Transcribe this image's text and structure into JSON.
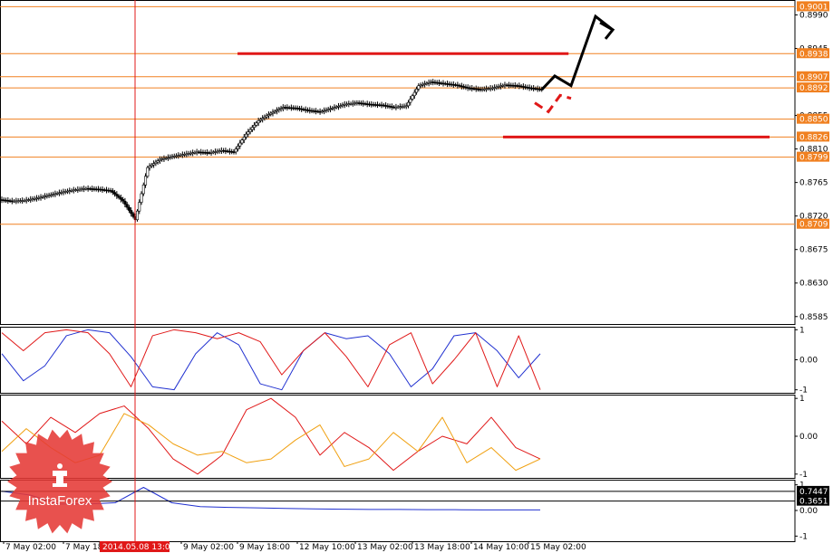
{
  "colors": {
    "level": "#f08020",
    "red": "#e01818",
    "blue": "#2030d0",
    "purple": "#8030a0",
    "orange": "#f0a010",
    "tag_bg": "#f08020",
    "dark_tag": "#000000",
    "brand": "#e53935"
  },
  "brand": {
    "name": "InstaForex",
    "icon": "instaforex-emblem-icon"
  },
  "chart_data": [
    {
      "type": "candlestick",
      "ylim": [
        0.8575,
        0.901
      ],
      "y_ticks": [
        "0.8990",
        "0.8945",
        "0.8855",
        "0.8810",
        "0.8765",
        "0.8720",
        "0.8675",
        "0.8630",
        "0.8585"
      ],
      "y_tick_values": [
        0.899,
        0.8945,
        0.8855,
        0.881,
        0.8765,
        0.872,
        0.8675,
        0.863,
        0.8585
      ],
      "levels": [
        {
          "label": "0.9001",
          "value": 0.9001
        },
        {
          "label": "0.8938",
          "value": 0.8938
        },
        {
          "label": "0.8907",
          "value": 0.8907
        },
        {
          "label": "0.8892",
          "value": 0.8892
        },
        {
          "label": "0.8850",
          "value": 0.885
        },
        {
          "label": "0.8826",
          "value": 0.8826
        },
        {
          "label": "0.8799",
          "value": 0.8799
        },
        {
          "label": "0.8709",
          "value": 0.8709
        }
      ],
      "price_path": [
        0.8742,
        0.874,
        0.8741,
        0.8744,
        0.8748,
        0.8752,
        0.8755,
        0.8757,
        0.8756,
        0.8754,
        0.874,
        0.8715,
        0.8785,
        0.8796,
        0.88,
        0.8803,
        0.8806,
        0.8805,
        0.8808,
        0.8806,
        0.883,
        0.8848,
        0.8858,
        0.8866,
        0.8865,
        0.8862,
        0.886,
        0.8865,
        0.887,
        0.8872,
        0.887,
        0.8869,
        0.8866,
        0.8868,
        0.8895,
        0.89,
        0.8898,
        0.8896,
        0.8892,
        0.889,
        0.8892,
        0.8896,
        0.8895,
        0.8892,
        0.889
      ],
      "support_resistance": [
        {
          "value": 0.8938,
          "from_index": 17,
          "to_index": 40
        },
        {
          "value": 0.8826,
          "from_index": 36,
          "to_index": 57
        }
      ],
      "forecast_black": [
        0.889,
        0.8908,
        0.8895,
        0.8988,
        0.897
      ],
      "forecast_red": [
        0.8872,
        0.886,
        0.8882,
        0.8878
      ],
      "vertical_marker_index": 12
    },
    {
      "type": "line",
      "ylim": [
        -1.1,
        1.1
      ],
      "y_ticks": [
        "1",
        "0.00",
        "-1"
      ],
      "series": [
        {
          "color_key": "blue",
          "values": [
            0.2,
            -0.7,
            -0.2,
            0.8,
            1.0,
            0.9,
            0.1,
            -0.9,
            -1.0,
            0.2,
            0.9,
            0.5,
            -0.8,
            -1.0,
            0.3,
            0.9,
            0.7,
            0.8,
            0.2,
            -0.9,
            -0.3,
            0.8,
            0.9,
            0.3,
            -0.6,
            0.2
          ]
        },
        {
          "color_key": "red",
          "values": [
            0.9,
            0.3,
            0.9,
            1.0,
            0.9,
            0.2,
            -0.9,
            0.8,
            1.0,
            0.9,
            0.7,
            0.9,
            0.6,
            -0.5,
            0.3,
            0.9,
            0.1,
            -0.9,
            0.5,
            0.9,
            -0.8,
            0.0,
            0.9,
            -0.9,
            0.8,
            -1.0
          ]
        },
        {
          "color_key": "black",
          "values": [
            0.4,
            -0.1,
            -0.8,
            -1.0,
            -0.9,
            0.1,
            0.9,
            1.0,
            0.9,
            0.8,
            0.9,
            0.8,
            0.4,
            -0.6,
            0.2,
            0.9,
            0.3,
            -0.8,
            0.6,
            0.9,
            -0.9,
            -0.1,
            0.9,
            -0.9,
            0.8,
            -1.0
          ]
        }
      ]
    },
    {
      "type": "line",
      "ylim": [
        -1.1,
        1.1
      ],
      "y_ticks": [
        "1",
        "0.00",
        "-1"
      ],
      "series": [
        {
          "color_key": "red",
          "values": [
            0.4,
            -0.2,
            0.5,
            0.1,
            0.6,
            0.8,
            0.2,
            -0.6,
            -1.0,
            -0.5,
            0.7,
            1.0,
            0.5,
            -0.5,
            0.1,
            -0.3,
            -0.9,
            -0.4,
            0.0,
            -0.2,
            0.5,
            -0.3,
            -0.6
          ]
        },
        {
          "color_key": "orange",
          "values": [
            -0.4,
            0.2,
            -0.3,
            -0.7,
            -0.5,
            0.6,
            0.3,
            -0.2,
            -0.5,
            -0.4,
            -0.7,
            -0.6,
            -0.1,
            0.3,
            -0.8,
            -0.6,
            0.1,
            -0.4,
            0.5,
            -0.7,
            -0.3,
            -0.9,
            -0.6
          ]
        },
        {
          "color_key": "black",
          "values": [
            0.8,
            0.6,
            0.4,
            -0.3,
            -0.7,
            -0.9,
            -0.5,
            -0.2,
            0.0,
            -0.3,
            -0.5,
            -0.4,
            -0.2,
            0.0,
            0.4,
            0.8,
            0.5,
            0.1,
            0.0,
            -0.1,
            -0.2,
            0.1,
            0.4
          ]
        }
      ]
    },
    {
      "type": "line",
      "ylim": [
        -1.2,
        1.2
      ],
      "y_ticks": [
        "1",
        "0.00",
        "-1"
      ],
      "tags": [
        {
          "label": "0.7447",
          "value": 0.7447
        },
        {
          "label": "0.3651",
          "value": 0.3651
        }
      ],
      "series": [
        {
          "color_key": "blue",
          "values": [
            0.75,
            0.6,
            0.25,
            0.25,
            0.3,
            0.9,
            0.3,
            0.15,
            0.12,
            0.1,
            0.08,
            0.06,
            0.05,
            0.04,
            0.04,
            0.03,
            0.03,
            0.02,
            0.02,
            0.02
          ]
        }
      ]
    }
  ],
  "x_axis": {
    "labels": [
      "7 May 02:00",
      "7 May 18:00",
      "2014.05.08 13:00",
      "9 May 02:00",
      "9 May 18:00",
      "12 May 10:00",
      "13 May 02:00",
      "13 May 18:00",
      "14 May 10:00",
      "15 May 02:00"
    ],
    "highlight_index": 2
  }
}
